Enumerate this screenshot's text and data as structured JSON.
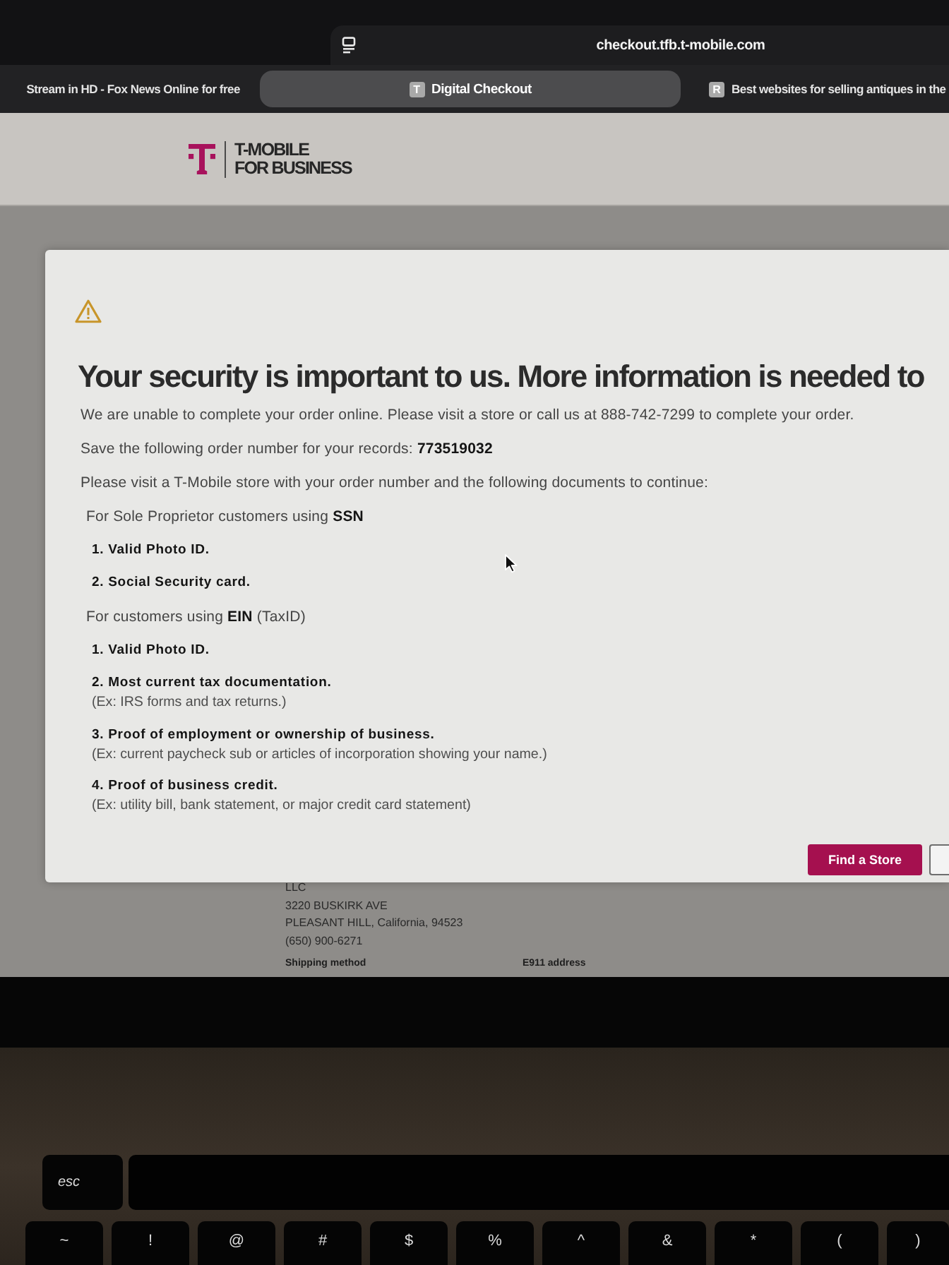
{
  "browser": {
    "address_bar": {
      "url": "checkout.tfb.t-mobile.com"
    },
    "tabs": [
      {
        "title": "Stream in HD - Fox News Online for free",
        "selected": false
      },
      {
        "favicon": "T",
        "title": "Digital Checkout",
        "selected": true
      },
      {
        "favicon": "R",
        "title": "Best websites for selling antiques in the",
        "selected": false
      }
    ]
  },
  "page": {
    "logo": [
      "T-MOBILE",
      "FOR BUSINESS"
    ],
    "address_lines": [
      "LLC",
      "3220 BUSKIRK AVE",
      "PLEASANT HILL, California, 94523",
      "(650) 900-6271"
    ],
    "section_labels": [
      "Shipping method",
      "E911 address"
    ]
  },
  "dialog": {
    "heading": "Your security is important to us. More information is needed to",
    "paragraphs": [
      "We are unable to complete your order online. Please visit a store or call us at 888-742-7299 to complete your order.",
      "Save the following order number for your records: **773519032**",
      "Please visit a T-Mobile store with your order number and the following documents to continue:"
    ],
    "groups": [
      {
        "title": "For Sole Proprietor customers using **SSN**",
        "items": [
          {
            "text": "1. Valid Photo ID."
          },
          {
            "text": "2. Social Security card."
          }
        ]
      },
      {
        "title": "For customers using **EIN** (TaxID)",
        "items": [
          {
            "text": "1. Valid Photo ID."
          },
          {
            "text": "2. Most current tax documentation.",
            "note": "(Ex: IRS forms and tax returns.)"
          },
          {
            "text": "3. Proof of employment or ownership of business.",
            "note": "(Ex: current paycheck sub or articles of incorporation showing your name.)"
          },
          {
            "text": "4. Proof of business credit.",
            "note": "(Ex: utility bill, bank statement, or major credit card statement)"
          }
        ]
      }
    ],
    "buttons": [
      {
        "kind": "primary",
        "label": "Find a Store"
      },
      {
        "kind": "outline"
      }
    ]
  },
  "keyboard": {
    "function_row": [
      {
        "kind": "key",
        "label": "esc"
      },
      {
        "kind": "touch_bar"
      }
    ],
    "number_row": [
      "~",
      "!",
      "@",
      "#",
      "$",
      "%",
      "^",
      "&",
      "*",
      "(",
      ")"
    ]
  }
}
